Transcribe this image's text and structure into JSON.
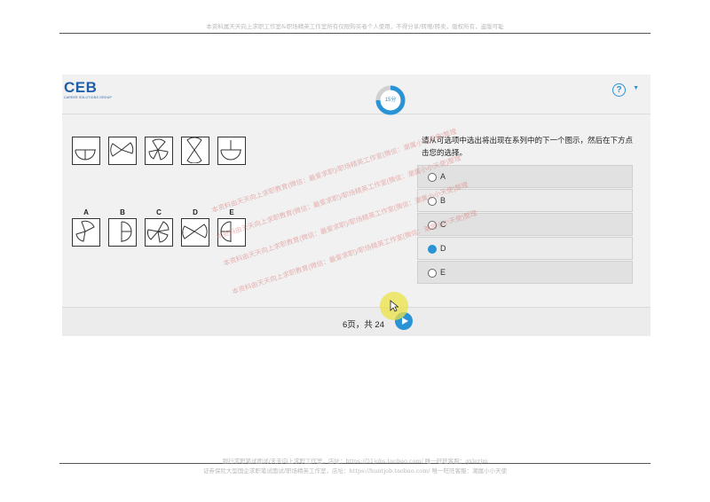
{
  "doc": {
    "header_note": "本资料属天天向上求职工作室&职场精英工作室所有仅限购买者个人使用，不得分享/转赠/转卖，版权所有，盗版可耻",
    "footer_line1": "银行求职笔试面试/天天向上求职工作室，店址：https://51jobs.taobao.com/ 唯一旺旺客服：gxlerjm",
    "footer_line2": "证券保险大型国企求职笔试面试/职场精英工作室，店址：https://huntjob.taobao.com/ 唯一旺旺客服：潮属小小天使"
  },
  "app": {
    "logo_text": "CEB",
    "logo_subtext": "CAREER SOLUTIONS GROUP",
    "timer_label": "15分",
    "timer_progress": 0.5,
    "help_icon": "question-circle-icon",
    "question_text": "请从可选项中选出将出现在系列中的下一个图示，然后在下方点击您的选择。",
    "answer_letters": [
      "A",
      "B",
      "C",
      "D",
      "E"
    ],
    "options": [
      {
        "label": "A",
        "selected": false
      },
      {
        "label": "B",
        "selected": false
      },
      {
        "label": "C",
        "selected": false
      },
      {
        "label": "D",
        "selected": true
      },
      {
        "label": "E",
        "selected": false
      }
    ],
    "page_info": "6页，共 24",
    "next_icon": "play-arrow-icon",
    "accent_color": "#2a93d5"
  },
  "watermark_text": "本资料由天天向上求职教育(微信：最爱求职)/职场精英工作室(微信：潮属小小天使)整理"
}
